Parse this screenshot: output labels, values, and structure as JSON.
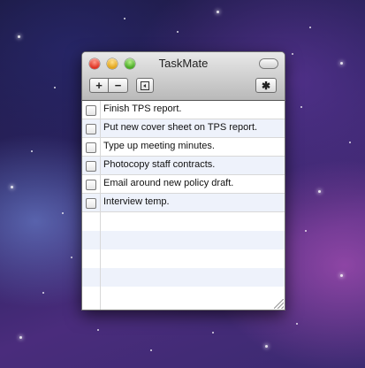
{
  "window": {
    "title": "TaskMate"
  },
  "toolbar": {
    "add_label": "+",
    "remove_label": "−",
    "gear_icon": "✱"
  },
  "tasks": [
    {
      "label": "Finish TPS report.",
      "checked": false
    },
    {
      "label": "Put new cover sheet on TPS report.",
      "checked": false
    },
    {
      "label": "Type up meeting minutes.",
      "checked": false
    },
    {
      "label": "Photocopy staff contracts.",
      "checked": false
    },
    {
      "label": "Email around new policy draft.",
      "checked": false
    },
    {
      "label": "Interview temp.",
      "checked": false
    }
  ],
  "colors": {
    "row_alt": "#eef2fb",
    "grid": "#d8d8d8"
  }
}
